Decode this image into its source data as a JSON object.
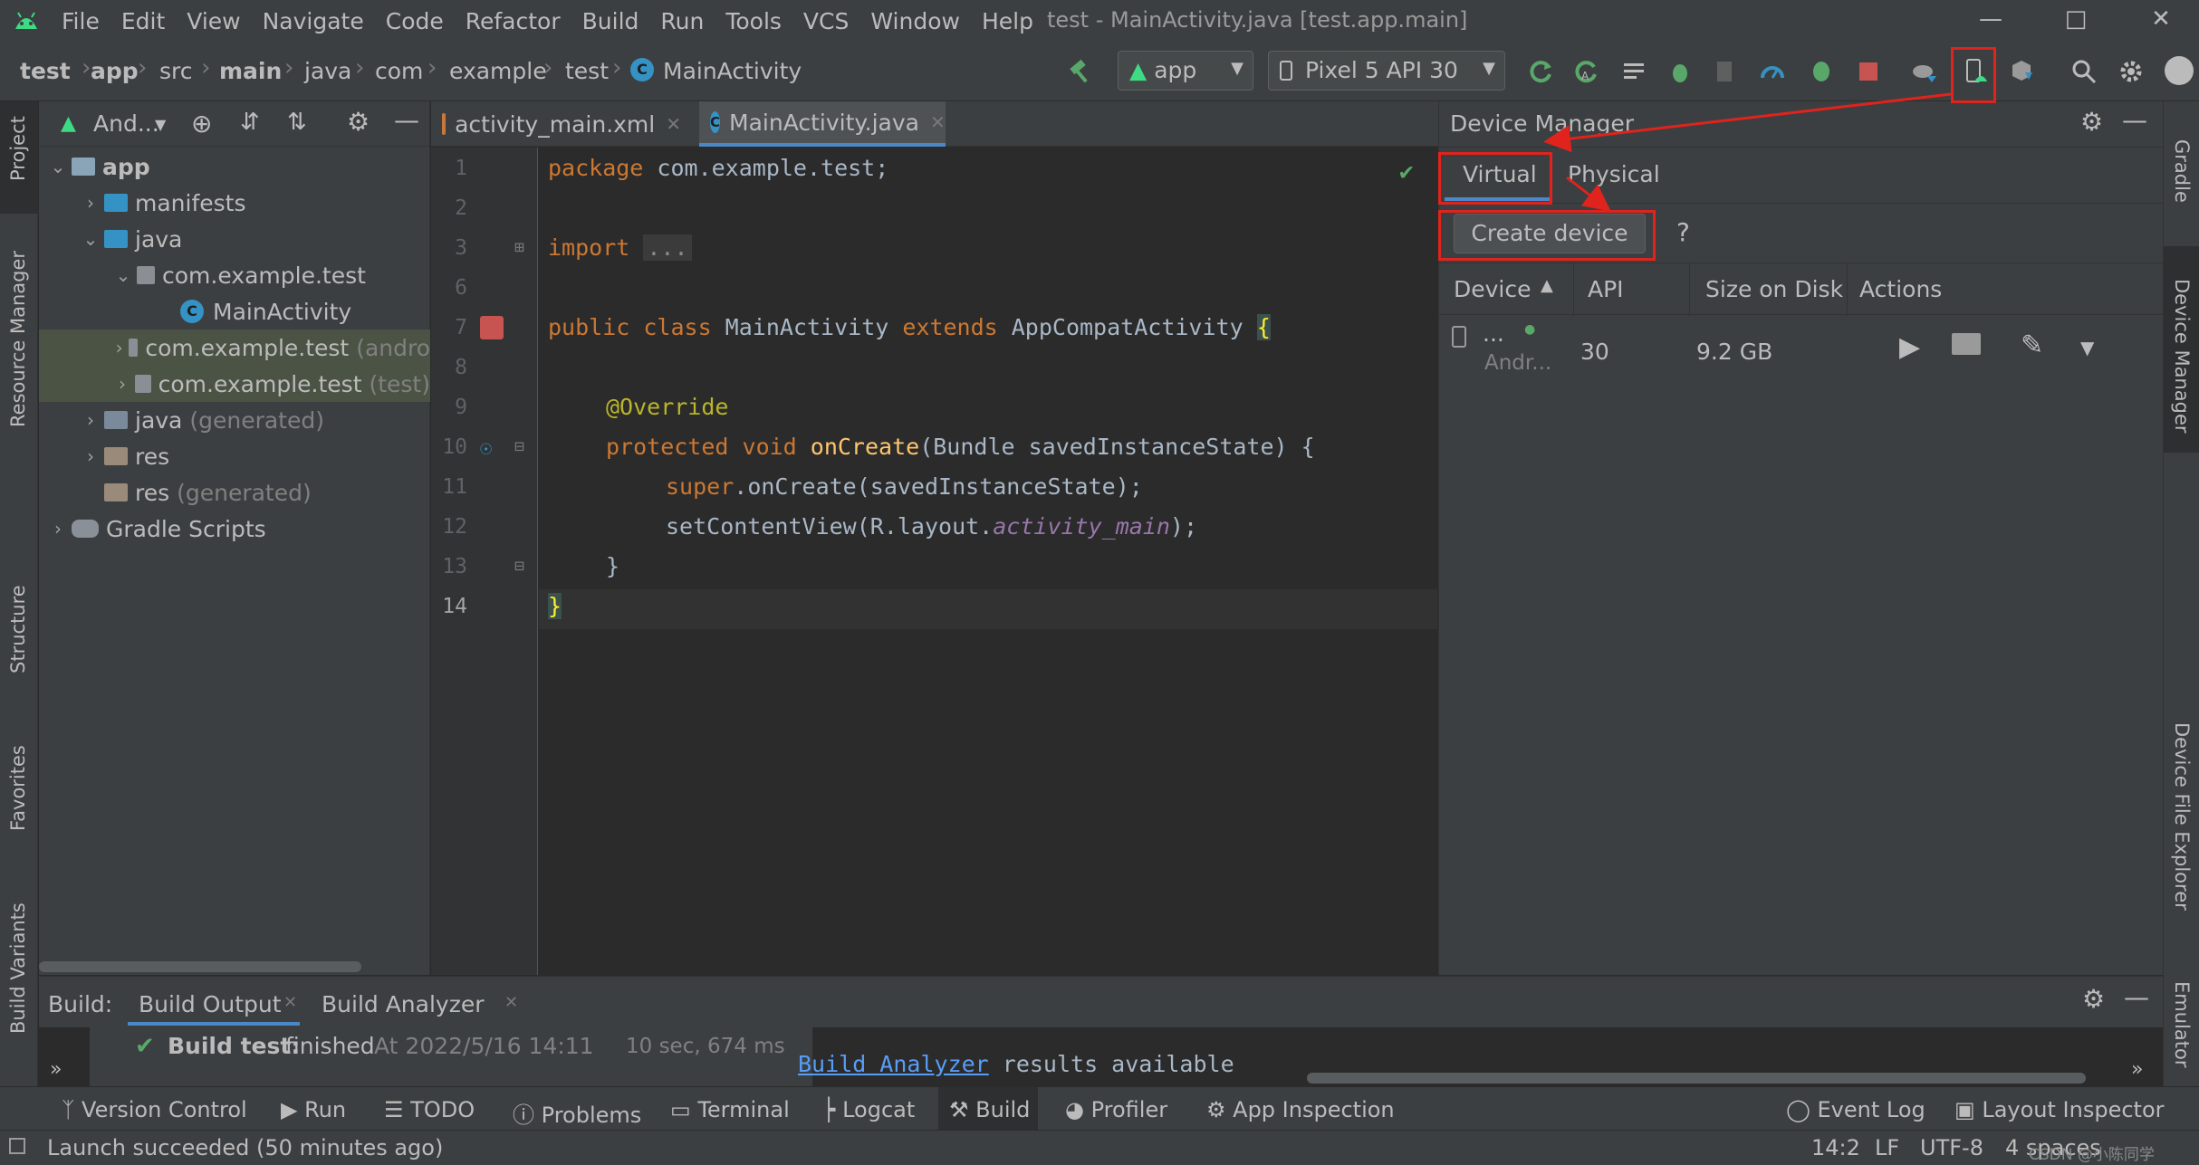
{
  "menu": [
    "File",
    "Edit",
    "View",
    "Navigate",
    "Code",
    "Refactor",
    "Build",
    "Run",
    "Tools",
    "VCS",
    "Window",
    "Help"
  ],
  "window_title": "test - MainActivity.java [test.app.main]",
  "breadcrumbs": [
    "test",
    "app",
    "src",
    "main",
    "java",
    "com",
    "example",
    "test",
    "MainActivity"
  ],
  "run_config": "app",
  "device_select": "Pixel 5 API 30",
  "project_panel": {
    "view_mode": "And...",
    "tree": [
      {
        "label": "app",
        "extra": ""
      },
      {
        "label": "manifests",
        "extra": ""
      },
      {
        "label": "java",
        "extra": ""
      },
      {
        "label": "com.example.test",
        "extra": ""
      },
      {
        "label": "MainActivity",
        "extra": ""
      },
      {
        "label": "com.example.test",
        "extra": "(andro"
      },
      {
        "label": "com.example.test",
        "extra": "(test)"
      },
      {
        "label": "java",
        "extra": "(generated)"
      },
      {
        "label": "res",
        "extra": ""
      },
      {
        "label": "res",
        "extra": "(generated)"
      },
      {
        "label": "Gradle Scripts",
        "extra": ""
      }
    ]
  },
  "editor": {
    "tabs": [
      "activity_main.xml",
      "MainActivity.java"
    ],
    "line_numbers": [
      "1",
      "2",
      "3",
      "6",
      "7",
      "8",
      "9",
      "10",
      "11",
      "12",
      "13",
      "14"
    ],
    "code": {
      "l1_kw": "package",
      "l1_rest": " com.example.test;",
      "l3_kw": "import",
      "l3_fold": "...",
      "l7_a": "public class",
      "l7_b": " MainActivity ",
      "l7_c": "extends",
      "l7_d": " AppCompatActivity ",
      "l7_e": "{",
      "l9": "@Override",
      "l10_a": "protected void",
      "l10_b": " onCreate",
      "l10_c": "(Bundle savedInstanceState) {",
      "l11_a": "super",
      "l11_b": ".onCreate(savedInstanceState);",
      "l12_a": "setContentView(R.layout.",
      "l12_b": "activity_main",
      "l12_c": ");",
      "l13": "}",
      "l14": "}"
    }
  },
  "device_manager": {
    "title": "Device Manager",
    "tabs": [
      "Virtual",
      "Physical"
    ],
    "create_button": "Create device",
    "help": "?",
    "columns": [
      "Device",
      "API",
      "Size on Disk",
      "Actions"
    ],
    "device": {
      "name": "...",
      "sub": "Andr...",
      "api": "30",
      "size": "9.2 GB"
    }
  },
  "build": {
    "label": "Build:",
    "tabs": [
      "Build Output",
      "Build Analyzer"
    ],
    "result_bold": "Build test:",
    "result_status": "finished",
    "result_time": "At 2022/5/16 14:11",
    "duration": "10 sec, 674 ms",
    "analyzer_link": "Build Analyzer",
    "analyzer_text": " results available"
  },
  "bottom_tools": [
    "Version Control",
    "Run",
    "TODO",
    "Problems",
    "Terminal",
    "Logcat",
    "Build",
    "Profiler",
    "App Inspection"
  ],
  "bottom_right_tools": [
    "Event Log",
    "Layout Inspector"
  ],
  "status": {
    "message": "Launch succeeded (50 minutes ago)",
    "position": "14:2",
    "line_sep": "LF",
    "encoding": "UTF-8",
    "indent": "4 spaces",
    "watermark": "CSDN @小陈同学"
  },
  "side_tools_left": [
    "Project",
    "Resource Manager",
    "Structure",
    "Favorites",
    "Build Variants"
  ],
  "side_tools_right": [
    "Gradle",
    "Device Manager",
    "Device File Explorer",
    "Emulator"
  ],
  "colors": {
    "accent_red": "#e0231c",
    "android_green": "#3ddc84",
    "selection": "#4b5345"
  }
}
